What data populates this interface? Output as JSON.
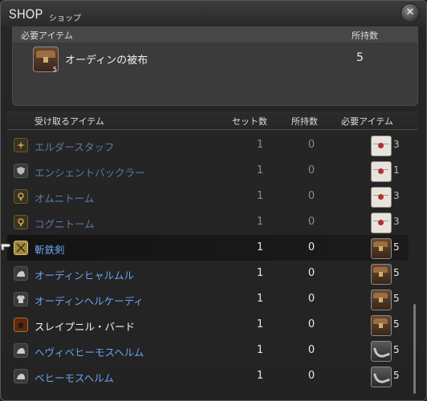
{
  "window": {
    "title": "SHOP",
    "subtitle": "ショップ",
    "close_glyph": "✕"
  },
  "required": {
    "header_item": "必要アイテム",
    "header_owned": "所持数",
    "item_name": "オーディンの被布",
    "item_sub": "5",
    "item_icon": "chest-icon",
    "owned": "5"
  },
  "list_header": {
    "item": "受け取るアイテム",
    "set_count": "セット数",
    "owned": "所持数",
    "required": "必要アイテム"
  },
  "rows": [
    {
      "name": "エルダースタッフ",
      "category_icon": "staff-icon",
      "set": "1",
      "owned": "0",
      "cost_icon": "letter-icon",
      "cost": "3"
    },
    {
      "name": "エンシェントバックラー",
      "category_icon": "shield-icon",
      "set": "1",
      "owned": "0",
      "cost_icon": "letter-icon",
      "cost": "1"
    },
    {
      "name": "オムニトーム",
      "category_icon": "tome-icon",
      "set": "1",
      "owned": "0",
      "cost_icon": "letter-icon",
      "cost": "3"
    },
    {
      "name": "コグニトーム",
      "category_icon": "tome-icon",
      "set": "1",
      "owned": "0",
      "cost_icon": "letter-icon",
      "cost": "3"
    },
    {
      "name": "斬鉄剣",
      "category_icon": "crossed-swords-icon",
      "set": "1",
      "owned": "0",
      "cost_icon": "chest-icon",
      "cost": "5"
    },
    {
      "name": "オーディンヒャルムル",
      "category_icon": "helmet-icon",
      "set": "1",
      "owned": "0",
      "cost_icon": "chest-icon",
      "cost": "5"
    },
    {
      "name": "オーディンヘルケーディ",
      "category_icon": "armor-icon",
      "set": "1",
      "owned": "0",
      "cost_icon": "chest-icon",
      "cost": "5"
    },
    {
      "name": "スレイプニル・バード",
      "category_icon": "star-icon",
      "set": "1",
      "owned": "0",
      "cost_icon": "chest-icon",
      "cost": "5"
    },
    {
      "name": "ヘヴィベヒーモスヘルム",
      "category_icon": "helmet-icon",
      "set": "1",
      "owned": "0",
      "cost_icon": "horn-icon",
      "cost": "5"
    },
    {
      "name": "ベヒーモスヘルム",
      "category_icon": "helmet-icon",
      "set": "1",
      "owned": "0",
      "cost_icon": "horn-icon",
      "cost": "5"
    }
  ],
  "colors": {
    "unavailable_text": "#5d79a8",
    "link_text": "#6aa2f0",
    "normal_text": "#f5f5f5"
  }
}
